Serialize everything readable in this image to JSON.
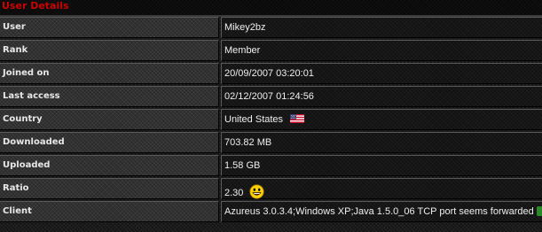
{
  "panel": {
    "title": "User Details",
    "title_color": "#cc0000"
  },
  "rows": [
    {
      "label": "User",
      "value": "Mikey2bz"
    },
    {
      "label": "Rank",
      "value": "Member"
    },
    {
      "label": "Joined on",
      "value": "20/09/2007 03:20:01"
    },
    {
      "label": "Last access",
      "value": "02/12/2007 01:24:56"
    },
    {
      "label": "Country",
      "value": "United States",
      "icon": "us-flag-icon"
    },
    {
      "label": "Downloaded",
      "value": "703.82 MB"
    },
    {
      "label": "Uploaded",
      "value": "1.58 GB"
    },
    {
      "label": "Ratio",
      "value": "2.30",
      "icon": "smiley-icon"
    },
    {
      "label": "Client",
      "value": "Azureus 3.0.3.4;Windows XP;Java 1.5.0_06 TCP port seems forwarded",
      "icon": "port-status-icon"
    }
  ]
}
